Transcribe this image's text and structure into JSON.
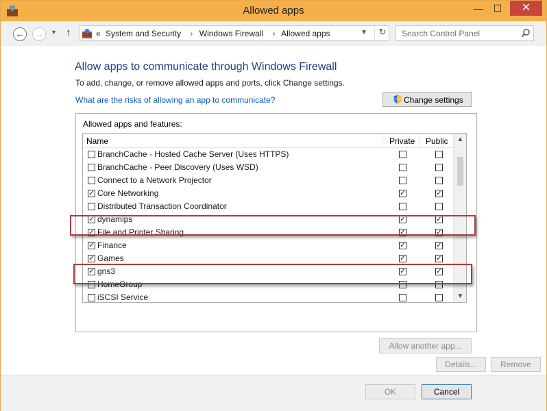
{
  "window": {
    "title": "Allowed apps",
    "accent_color": "#f5b04a",
    "close_color": "#c7463b"
  },
  "address_bar": {
    "prefix": "«",
    "breadcrumb": [
      "System and Security",
      "Windows Firewall",
      "Allowed apps"
    ],
    "separator": "›"
  },
  "search": {
    "placeholder": "Search Control Panel"
  },
  "content": {
    "heading": "Allow apps to communicate through Windows Firewall",
    "subtext": "To add, change, or remove allowed apps and ports, click Change settings.",
    "risk_link": "What are the risks of allowing an app to communicate?",
    "change_settings_label": "Change settings",
    "group_title": "Allowed apps and features:",
    "columns": {
      "name": "Name",
      "private": "Private",
      "public": "Public"
    },
    "apps": [
      {
        "name": "BranchCache - Hosted Cache Server (Uses HTTPS)",
        "enabled": false,
        "private": false,
        "public": false
      },
      {
        "name": "BranchCache - Peer Discovery (Uses WSD)",
        "enabled": false,
        "private": false,
        "public": false
      },
      {
        "name": "Connect to a Network Projector",
        "enabled": false,
        "private": false,
        "public": false
      },
      {
        "name": "Core Networking",
        "enabled": true,
        "private": true,
        "public": true
      },
      {
        "name": "Distributed Transaction Coordinator",
        "enabled": false,
        "private": false,
        "public": false
      },
      {
        "name": "dynamips",
        "enabled": true,
        "private": true,
        "public": true
      },
      {
        "name": "File and Printer Sharing",
        "enabled": true,
        "private": true,
        "public": true
      },
      {
        "name": "Finance",
        "enabled": true,
        "private": true,
        "public": true
      },
      {
        "name": "Games",
        "enabled": true,
        "private": true,
        "public": true
      },
      {
        "name": "gns3",
        "enabled": true,
        "private": true,
        "public": true
      },
      {
        "name": "HomeGroup",
        "enabled": false,
        "private": false,
        "public": false
      },
      {
        "name": "iSCSI Service",
        "enabled": false,
        "private": false,
        "public": false
      }
    ],
    "details_label": "Details...",
    "remove_label": "Remove",
    "allow_another_label": "Allow another app...",
    "highlight_color": "#b23a3a"
  },
  "footer": {
    "ok_label": "OK",
    "cancel_label": "Cancel"
  }
}
